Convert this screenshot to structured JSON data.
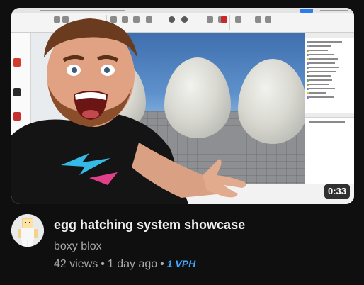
{
  "thumbnail": {
    "duration": "0:33"
  },
  "video": {
    "title": "egg hatching system showcase",
    "channel": "boxy blox",
    "views": "42 views",
    "age": "1 day ago",
    "vph": "1 VPH",
    "separator": "•"
  },
  "colors": {
    "background": "#0f0f0f",
    "title": "#f1f1f1",
    "secondary_text": "#aaaaaa",
    "vph": "#3ea6ff",
    "duration_bg": "#000000"
  },
  "icons": {
    "avatar": "roblox-character-avatar",
    "person": "excited-presenter-cutout"
  }
}
